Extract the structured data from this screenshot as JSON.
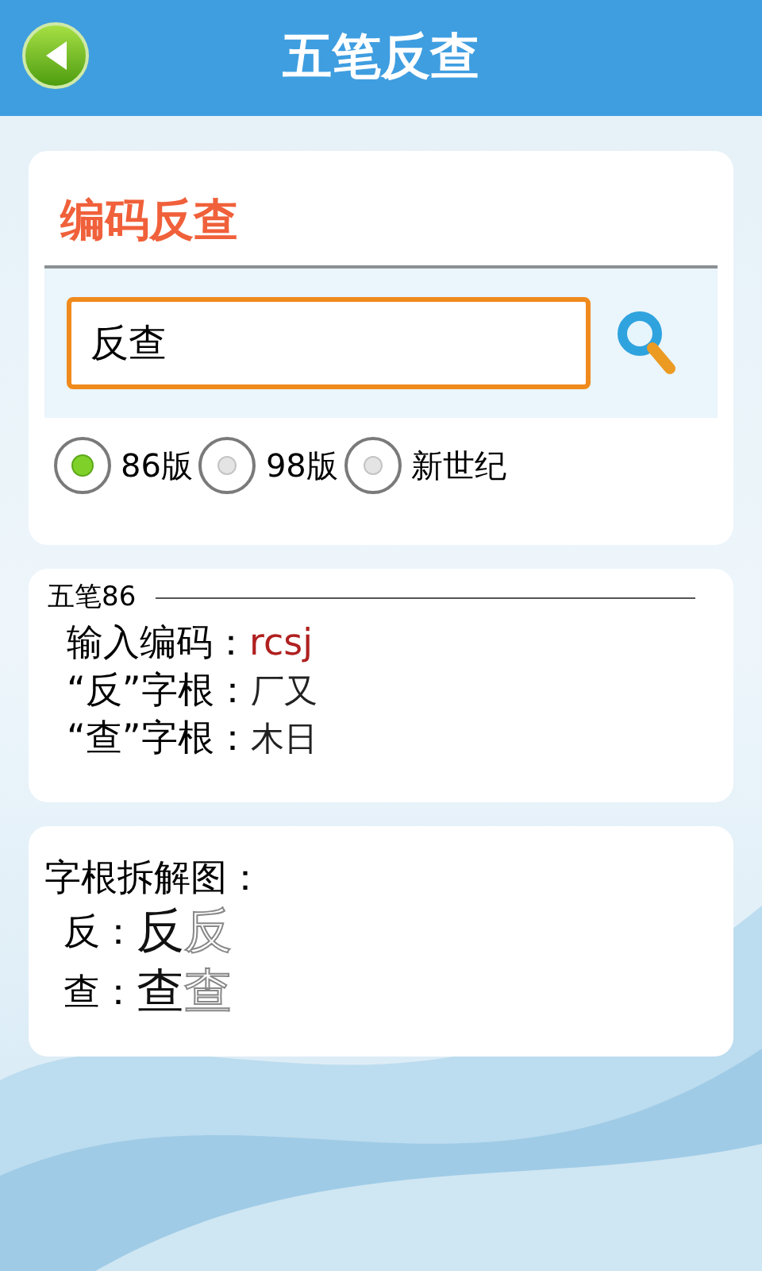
{
  "header": {
    "title": "五笔反查"
  },
  "search_card": {
    "title": "编码反查",
    "field": {
      "value": "反查"
    },
    "versions": [
      {
        "label": "86版",
        "selected": true
      },
      {
        "label": "98版",
        "selected": false
      },
      {
        "label": "新世纪",
        "selected": false
      }
    ]
  },
  "result_card": {
    "heading": "五笔86",
    "rows": [
      {
        "label": "输入编码：",
        "value": "rcsj",
        "kind": "code"
      },
      {
        "label": "“反”字根：",
        "value": "厂又",
        "kind": "root"
      },
      {
        "label": "“查”字根：",
        "value": "木日",
        "kind": "root"
      }
    ]
  },
  "diagram_card": {
    "title": "字根拆解图：",
    "rows": [
      {
        "label": "反：",
        "glyphs": [
          "反",
          "反"
        ]
      },
      {
        "label": "查：",
        "glyphs": [
          "查",
          "查"
        ]
      }
    ]
  }
}
